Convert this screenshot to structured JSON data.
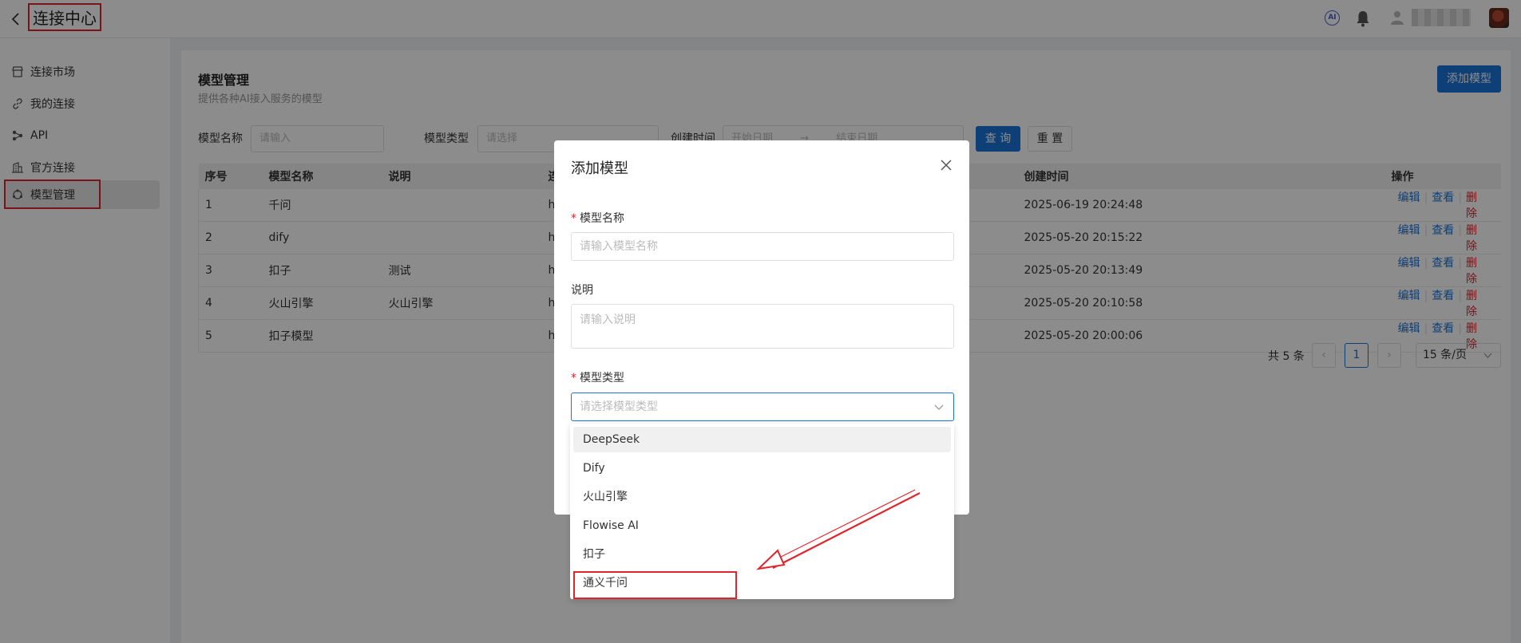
{
  "app": {
    "title": "连接中心"
  },
  "sidebar": {
    "items": [
      {
        "label": "连接市场",
        "icon": "store-icon"
      },
      {
        "label": "我的连接",
        "icon": "link-icon"
      },
      {
        "label": "API",
        "icon": "api-icon"
      },
      {
        "label": "官方连接",
        "icon": "building-icon"
      },
      {
        "label": "模型管理",
        "icon": "model-icon",
        "active": true
      }
    ]
  },
  "header": {
    "title": "模型管理",
    "subtitle": "提供各种AI接入服务的模型",
    "add_button": "添加模型"
  },
  "filters": {
    "name_label": "模型名称",
    "name_placeholder": "请输入",
    "type_label": "模型类型",
    "type_placeholder": "请选择",
    "date_label": "创建时间",
    "start_placeholder": "开始日期",
    "end_placeholder": "结束日期",
    "query_button": "查 询",
    "reset_button": "重 置"
  },
  "table": {
    "columns": [
      "序号",
      "模型名称",
      "说明",
      "连",
      "创建时间",
      "操作"
    ],
    "rows": [
      {
        "no": "1",
        "name": "千问",
        "desc": "",
        "conn": "h",
        "created": "2025-06-19 20:24:48"
      },
      {
        "no": "2",
        "name": "dify",
        "desc": "",
        "conn": "h",
        "created": "2025-05-20 20:15:22"
      },
      {
        "no": "3",
        "name": "扣子",
        "desc": "测试",
        "conn": "h",
        "created": "2025-05-20 20:13:49"
      },
      {
        "no": "4",
        "name": "火山引擎",
        "desc": "火山引擎",
        "conn": "h",
        "created": "2025-05-20 20:10:58"
      },
      {
        "no": "5",
        "name": "扣子模型",
        "desc": "",
        "conn": "h",
        "created": "2025-05-20 20:00:06"
      }
    ],
    "actions": {
      "edit": "编辑",
      "view": "查看",
      "delete": "删除"
    }
  },
  "pagination": {
    "total": "共 5 条",
    "current": "1",
    "page_size": "15 条/页"
  },
  "modal": {
    "title": "添加模型",
    "name_label": "模型名称",
    "name_placeholder": "请输入模型名称",
    "desc_label": "说明",
    "desc_placeholder": "请输入说明",
    "type_label": "模型类型",
    "type_placeholder": "请选择模型类型",
    "options": [
      "DeepSeek",
      "Dify",
      "火山引擎",
      "Flowise AI",
      "扣子",
      "通义千问"
    ]
  },
  "colors": {
    "primary": "#1a73d9",
    "danger": "#e0262d",
    "annotation": "#e0262d"
  }
}
